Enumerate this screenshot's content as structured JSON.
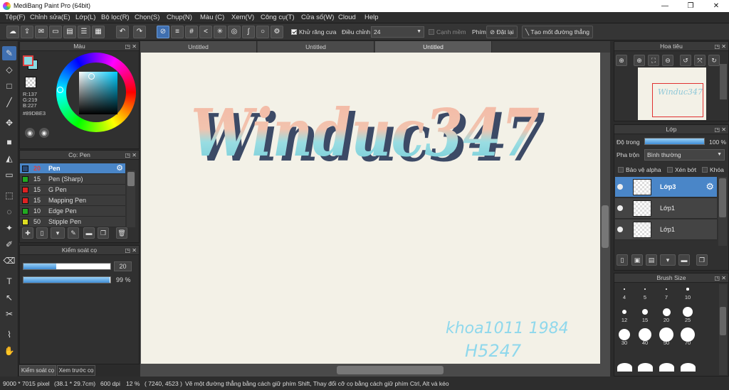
{
  "window": {
    "title": "MediBang Paint Pro (64bit)",
    "min": "—",
    "max": "❐",
    "close": "✕"
  },
  "menu": [
    "Tệp(F)",
    "Chỉnh sửa(E)",
    "Lớp(L)",
    "Bộ lọc(R)",
    "Chọn(S)",
    "Chụp(N)",
    "Màu (C)",
    "Xem(V)",
    "Công cụ(T)",
    "Cửa sổ(W)",
    "Cloud",
    "Help"
  ],
  "toolbar": {
    "antialias_label": "Khử răng cưa",
    "adjust_label": "Điều chỉnh",
    "adjust_value": "24",
    "sharpen_label": "Cạnh mềm",
    "key_label": "Phím",
    "reset_label": "Đặt lại",
    "line_label": "Tạo mốt đường thẳng"
  },
  "color_panel": {
    "title": "Màu",
    "r": "R:137",
    "g": "G:219",
    "b": "B:227",
    "hex": "#89DBE3",
    "fg": "#89dbe3"
  },
  "brush_panel": {
    "title": "Cọ: Pen",
    "items": [
      {
        "size": "20",
        "name": "Pen",
        "color": "#2a4b7a"
      },
      {
        "size": "15",
        "name": "Pen (Sharp)",
        "color": "#22aa22"
      },
      {
        "size": "15",
        "name": "G Pen",
        "color": "#dd2222"
      },
      {
        "size": "15",
        "name": "Mapping Pen",
        "color": "#dd2222"
      },
      {
        "size": "10",
        "name": "Edge Pen",
        "color": "#22aa22"
      },
      {
        "size": "50",
        "name": "Stipple Pen",
        "color": "#dddd22"
      }
    ]
  },
  "brush_control": {
    "title": "Kiểm soát cọ",
    "size_value": "20",
    "size_fraction": 0.38,
    "opacity_value": "99 %",
    "opacity_fraction": 0.99
  },
  "left_tabs": [
    "Kiểm soát cọ",
    "Xem trước cọ"
  ],
  "canvas_tabs": [
    "Untitled",
    "Untitled",
    "Untitled"
  ],
  "canvas": {
    "main_text": "Winduc347",
    "sig1": "khoa1011 1984",
    "sig2": "H5247"
  },
  "navigator": {
    "title": "Hoa tiêu",
    "thumb_text": "Winduc347"
  },
  "layer_panel": {
    "title": "Lớp",
    "opacity_label": "Độ trong",
    "opacity_value": "100 %",
    "opacity_fraction": 1.0,
    "blend_label": "Pha trộn",
    "blend_value": "Bình thường",
    "protect_alpha": "Bảo vệ alpha",
    "clip": "Xén bớt",
    "lock": "Khóa",
    "layers": [
      {
        "name": "Lớp3"
      },
      {
        "name": "Lớp1"
      },
      {
        "name": "Lớp1"
      }
    ]
  },
  "brush_size_panel": {
    "title": "Brush Size",
    "sizes": [
      "4",
      "5",
      "7",
      "10",
      "12",
      "15",
      "20",
      "25",
      "30",
      "40",
      "50",
      "70"
    ]
  },
  "status": {
    "dims": "9000 * 7015 pixel",
    "cm": "(38.1 * 29.7cm)",
    "dpi": "600 dpi",
    "zoom": "12 %",
    "coords": "( 7240, 4523 )",
    "hint": "Vẽ một đường thẳng bằng cách giữ phím Shift, Thay đổi cỡ cọ bằng cách giữ phím Ctrl, Alt và kéo"
  },
  "colors": {
    "accent": "#4a86c8",
    "text_peach": "#f2b8a2",
    "text_cyan": "#8fdbe3",
    "shadow": "#3c4a66"
  }
}
